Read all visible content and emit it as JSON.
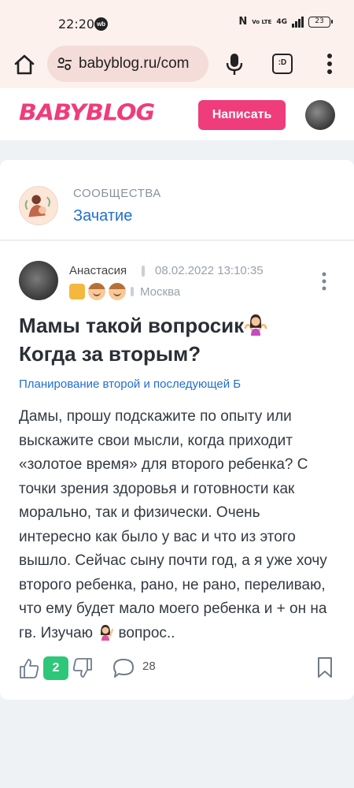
{
  "status_bar": {
    "time": "22:20",
    "app_badge": "wb",
    "nfc": "N",
    "volte": "Vo LTE",
    "network": "4G",
    "battery": "23"
  },
  "browser": {
    "url": "babyblog.ru/com",
    "tab_count_label": ":D"
  },
  "header": {
    "logo": "BABYBLOG",
    "write_button": "Написать"
  },
  "community": {
    "kicker": "СООБЩЕСТВА",
    "name": "Зачатие"
  },
  "post": {
    "author": "Анастасия",
    "date": "08.02.2022 13:10:35",
    "city": "Москва",
    "title": "Мамы такой вопросик",
    "title_line2": "Когда за вторым?",
    "rubric": "Планирование второй и последующей Б",
    "body": "Дамы, прошу подскажите по опыту или выскажите свои мысли, когда приходит «золотое время» для второго ребенка? С точки зрения здоровья и готовности как морально, так и физически. Очень интересно как было у вас и что из этого вышло. Сейчас сыну почти год, а я уже хочу второго ребенка, рано, не рано, переливаю, что ему будет мало моего ребенка и + он на гв. Изучаю",
    "body_tail": " вопрос..",
    "score": "2",
    "comments": "28"
  },
  "colors": {
    "brand_pink": "#ef3c7b",
    "link_blue": "#1f6fd1",
    "score_green": "#2ec77a",
    "browser_bg": "#fdf1ee"
  },
  "icons": [
    "home-icon",
    "tune-icon",
    "mic-icon",
    "tabs-icon",
    "more-vert-icon",
    "thumb-up-icon",
    "thumb-down-icon",
    "comment-icon",
    "bookmark-icon",
    "shrug-emoji",
    "raising-hand-emoji"
  ]
}
